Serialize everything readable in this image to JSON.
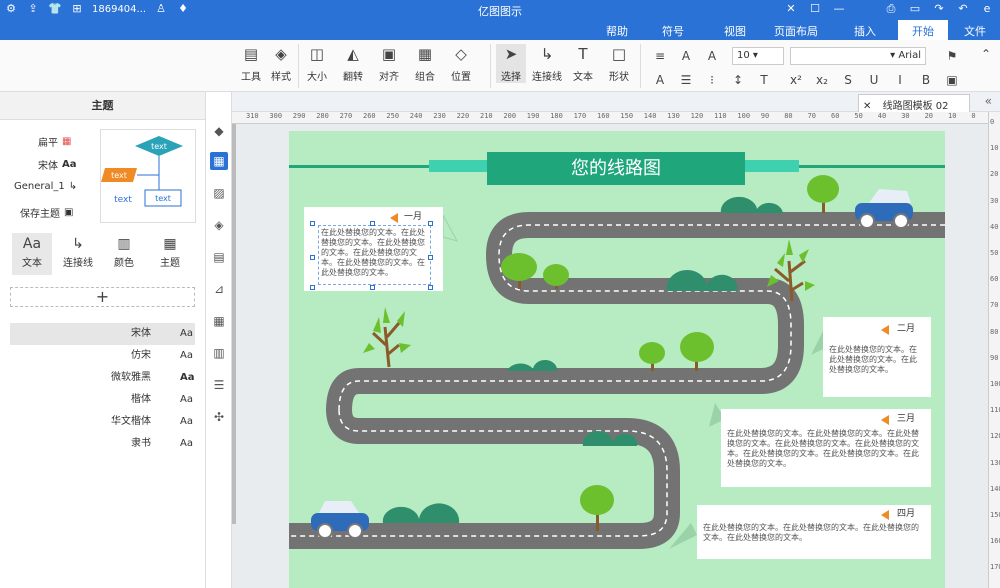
{
  "titlebar": {
    "title": "亿图图示",
    "user": "1869404...",
    "icons": [
      "logo-icon",
      "minimize-icon",
      "maximize-icon",
      "close-icon",
      "undo-icon",
      "redo-icon",
      "save-icon",
      "print-icon"
    ]
  },
  "menubar": {
    "items": [
      "文件",
      "开始",
      "插入",
      "页面布局",
      "视图",
      "符号",
      "帮助"
    ],
    "active": "开始"
  },
  "ribbon": {
    "tools": [
      {
        "label": "工具",
        "icon": "▤"
      },
      {
        "label": "样式",
        "icon": "◈"
      },
      {
        "label": "大小",
        "icon": "◫"
      },
      {
        "label": "翻转",
        "icon": "◭"
      },
      {
        "label": "对齐",
        "icon": "▣"
      },
      {
        "label": "组合",
        "icon": "▦"
      },
      {
        "label": "位置",
        "icon": "◇"
      },
      {
        "label": "选择",
        "icon": "➤"
      },
      {
        "label": "连接线",
        "icon": "↳"
      },
      {
        "label": "文本",
        "icon": "T"
      },
      {
        "label": "形状",
        "icon": "□"
      }
    ],
    "font_name": "Arial",
    "font_size": "10"
  },
  "tabs": {
    "doc_tab": "线路图模板 02"
  },
  "ruler": {
    "h": [
      "310",
      "300",
      "290",
      "280",
      "270",
      "260",
      "250",
      "240",
      "230",
      "220",
      "210",
      "200",
      "190",
      "180",
      "170",
      "160",
      "150",
      "140",
      "130",
      "120",
      "110",
      "100",
      "90",
      "80",
      "70",
      "60",
      "50",
      "40",
      "30",
      "20",
      "10",
      "0",
      "-10",
      "-20"
    ],
    "v": [
      "0",
      "10",
      "20",
      "30",
      "40",
      "50",
      "60",
      "70",
      "80",
      "90",
      "100",
      "110",
      "120",
      "130",
      "140",
      "150",
      "160",
      "170"
    ]
  },
  "panel": {
    "title": "主题",
    "items": [
      {
        "label": "扁平",
        "icon": "▦"
      },
      {
        "label": "宋体",
        "icon": "Aa"
      },
      {
        "label": "General_1",
        "icon": "↳"
      },
      {
        "label": "保存主题",
        "icon": "💾"
      }
    ],
    "quick": [
      {
        "label": "主题",
        "icon": "▦"
      },
      {
        "label": "颜色",
        "icon": "▥"
      },
      {
        "label": "连接线",
        "icon": "↳"
      },
      {
        "label": "文本",
        "icon": "Aa"
      }
    ],
    "preview_text": [
      "text",
      "text",
      "text",
      "text"
    ],
    "add_label": "+",
    "fonts": [
      {
        "name": "宋体",
        "sample": "Aa"
      },
      {
        "name": "仿宋",
        "sample": "Aa"
      },
      {
        "name": "微软雅黑",
        "sample": "Aa"
      },
      {
        "name": "楷体",
        "sample": "Aa"
      },
      {
        "name": "华文楷体",
        "sample": "Aa"
      },
      {
        "name": "隶书",
        "sample": "Aa"
      }
    ]
  },
  "diagram": {
    "title": "您的线路图",
    "notes": [
      {
        "month": "一月",
        "text": "在此处替换您的文本。在此处替换您的文本。在此处替换您的文本。在此处替换您的文本。在此处替换您的文本。在此处替换您的文本。"
      },
      {
        "month": "二月",
        "text": "在此处替换您的文本。在此处替换您的文本。在此处替换您的文本。"
      },
      {
        "month": "三月",
        "text": "在此处替换您的文本。在此处替换您的文本。在此处替换您的文本。在此处替换您的文本。在此处替换您的文本。在此处替换您的文本。在此处替换您的文本。在此处替换您的文本。"
      },
      {
        "month": "四月",
        "text": "在此处替换您的文本。在此处替换您的文本。在此处替换您的文本。在此处替换您的文本。"
      }
    ]
  },
  "colors": {
    "accent": "#2a72d6",
    "page": "#b7ebc1",
    "road": "#737373",
    "banner": "#1fa67a",
    "tree": "#6cc02e",
    "bush": "#2f8f6c",
    "car": "#2e6bb8",
    "flag": "#f08a24"
  }
}
